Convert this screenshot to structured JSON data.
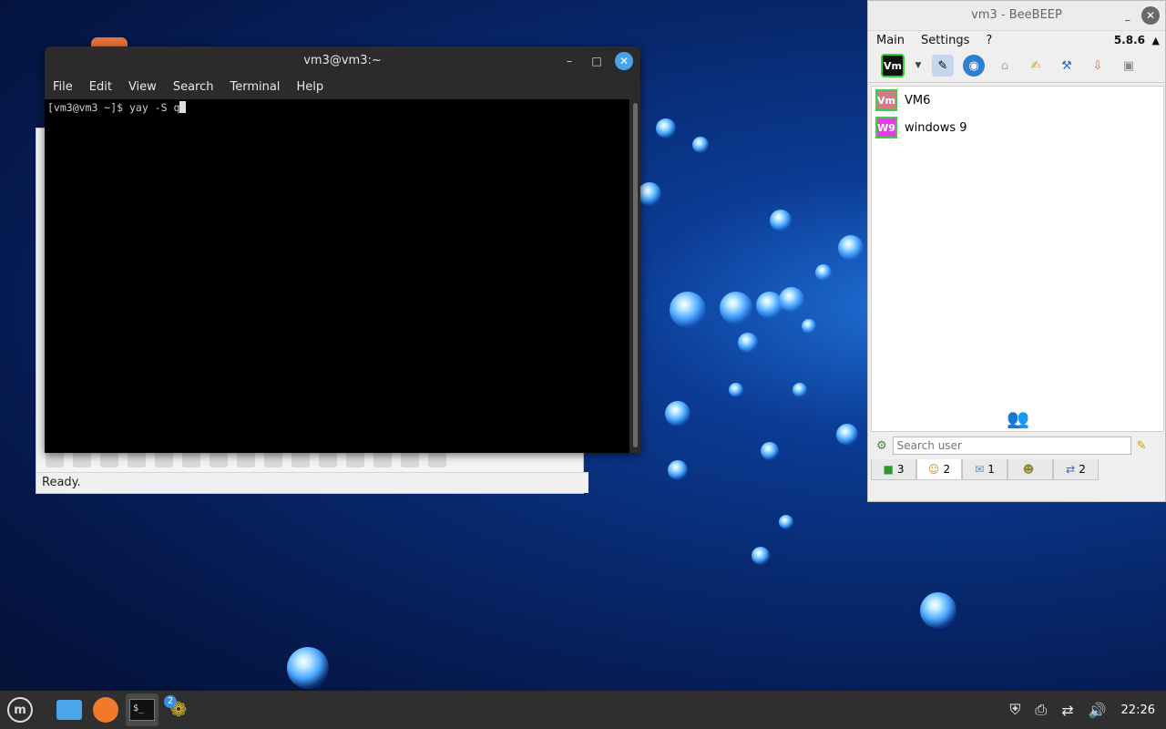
{
  "background_window": {
    "status": "Ready."
  },
  "terminal": {
    "title": "vm3@vm3:~",
    "menu": [
      "File",
      "Edit",
      "View",
      "Search",
      "Terminal",
      "Help"
    ],
    "prompt_line": "[vm3@vm3 ~]$ yay -S q"
  },
  "beebeep": {
    "title": "vm3 - BeeBEEP",
    "menu": [
      "Main",
      "Settings",
      "?"
    ],
    "version": "5.8.6",
    "status_badge": "Vm",
    "users": [
      {
        "initials": "Vm",
        "name": "VM6",
        "color": "#d07a8a"
      },
      {
        "initials": "W9",
        "name": "windows 9",
        "color": "#e040e0"
      }
    ],
    "search_placeholder": "Search user",
    "tabs": [
      {
        "icon": "monitor-icon",
        "count": "3"
      },
      {
        "icon": "users-icon",
        "count": "2"
      },
      {
        "icon": "chat-icon",
        "count": "1"
      },
      {
        "icon": "group-icon",
        "count": ""
      },
      {
        "icon": "share-icon",
        "count": "2"
      }
    ]
  },
  "taskbar": {
    "beebeep_badge": "2",
    "clock": "22:26"
  }
}
